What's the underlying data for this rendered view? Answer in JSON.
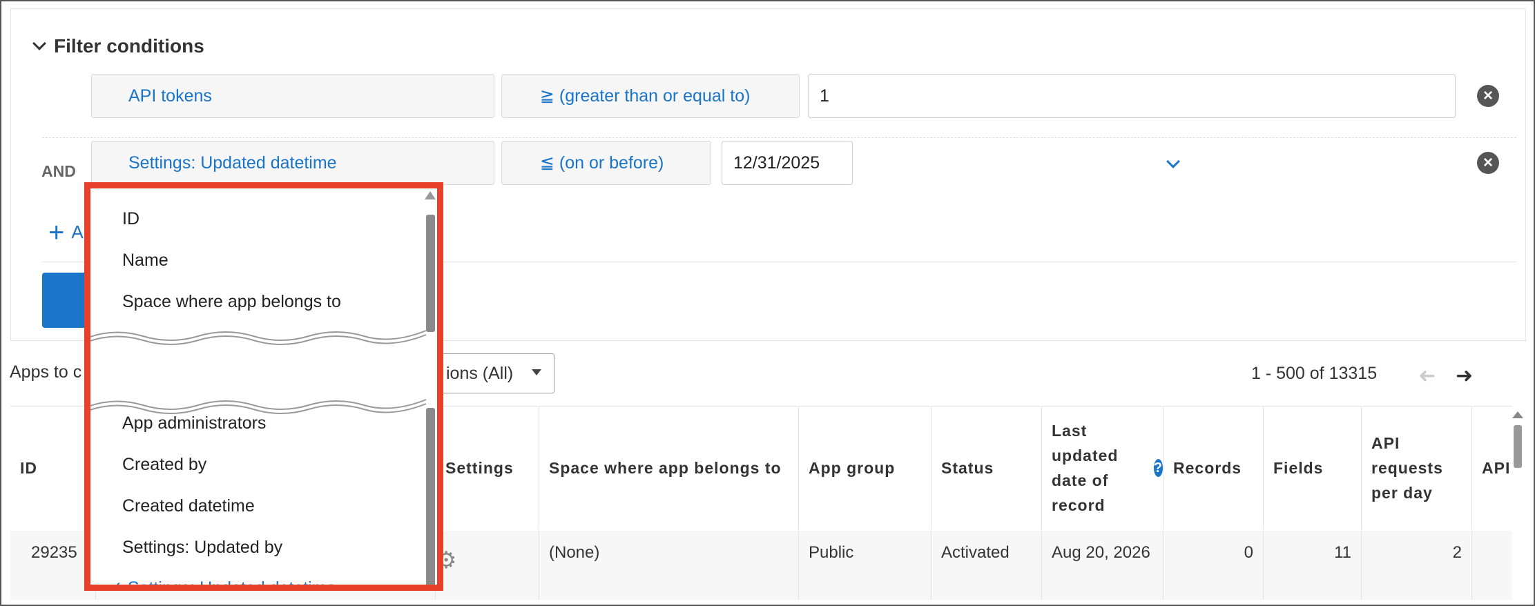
{
  "filter": {
    "title": "Filter conditions",
    "row1": {
      "field": "API tokens",
      "operator": "≧ (greater than or equal to)",
      "value": "1"
    },
    "row2": {
      "conjunction": "AND",
      "field": "Settings: Updated datetime",
      "operator": "≦ (on or before)",
      "value": "12/31/2025"
    },
    "add_label": "Ac",
    "remove_glyph": "×"
  },
  "toolbar": {
    "apps_label": "Apps to c",
    "actions_label": "ions (All)",
    "pager": "1 - 500 of 13315"
  },
  "table": {
    "headers": {
      "id": "ID",
      "settings": "Settings",
      "space": "Space where app belongs to",
      "app_group": "App group",
      "status": "Status",
      "last_updated": "Last updated date of record",
      "records": "Records",
      "fields": "Fields",
      "api_requests": "API requests per day",
      "api_tokens": "API toke"
    },
    "row": {
      "id": "29235",
      "space": "(None)",
      "app_group": "Public",
      "status": "Activated",
      "last_updated": "Aug 20, 2026",
      "records": "0",
      "fields": "11",
      "api_requests": "2"
    }
  },
  "dropdown": {
    "top_options": [
      "ID",
      "Name",
      "Space where app belongs to"
    ],
    "bottom_options": [
      "App administrators",
      "Created by",
      "Created datetime",
      "Settings: Updated by"
    ],
    "selected_option": "✓ Settings: Updated datetime"
  },
  "colors": {
    "accent": "#1a74c7",
    "highlight": "#e8402a"
  }
}
